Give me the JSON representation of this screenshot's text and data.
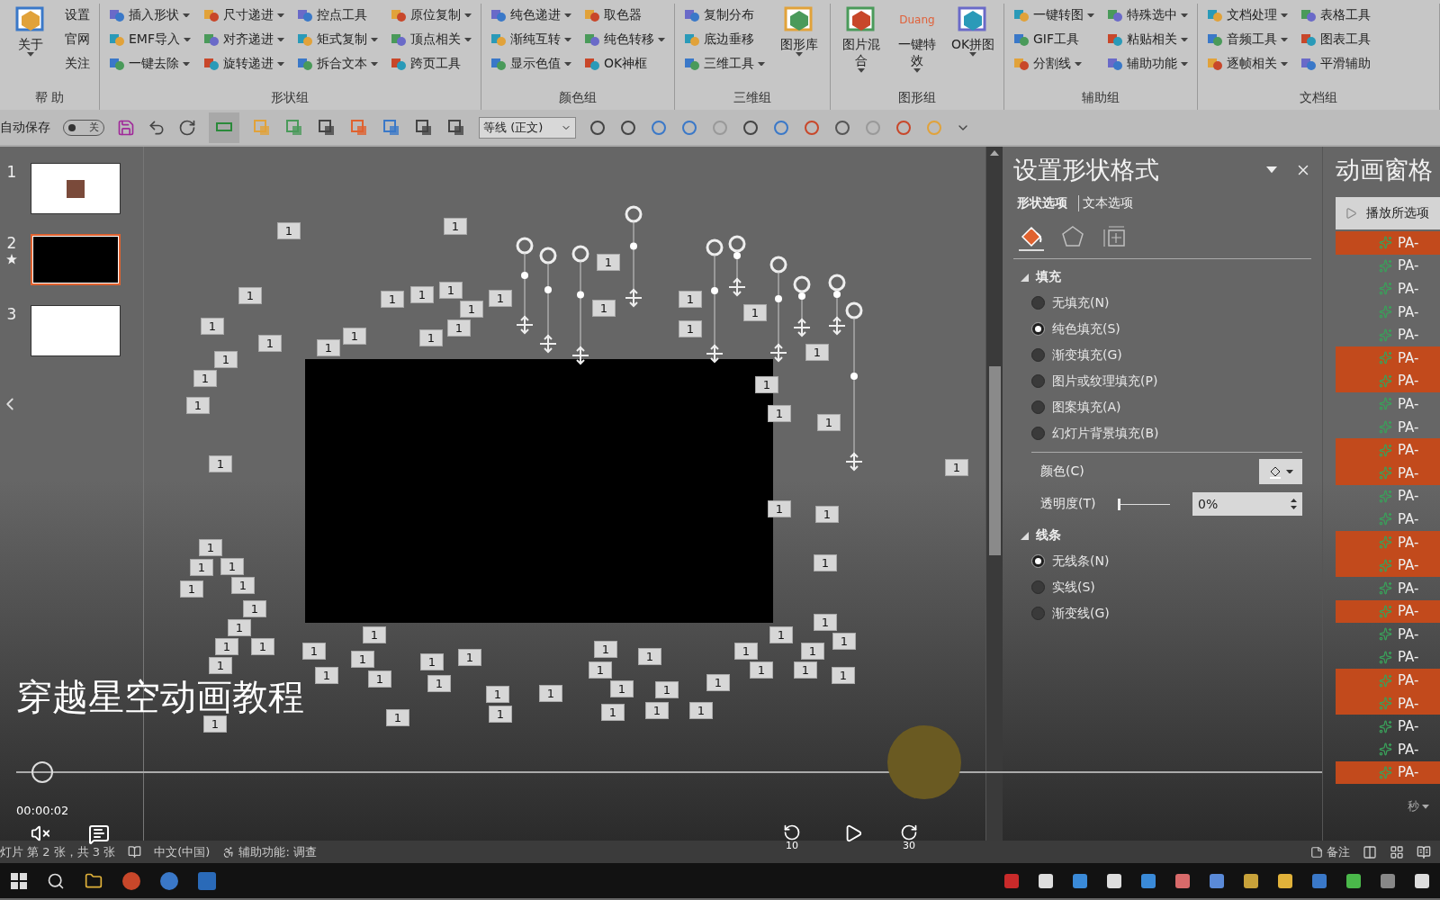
{
  "ribbon": {
    "groups": [
      {
        "label": "帮 助",
        "columns": [
          [
            {
              "label": "关于",
              "kind": "large",
              "dropdown": true
            }
          ],
          [
            {
              "label": "设置",
              "kind": "plain",
              "dropdown": false
            },
            {
              "label": "官网",
              "kind": "plain",
              "dropdown": false
            },
            {
              "label": "关注",
              "kind": "plain",
              "dropdown": false
            }
          ]
        ]
      },
      {
        "label": "形状组",
        "columns": [
          [
            {
              "label": "插入形状",
              "kind": "small",
              "dropdown": true
            },
            {
              "label": "EMF导入",
              "kind": "small",
              "dropdown": true
            },
            {
              "label": "一键去除",
              "kind": "small",
              "dropdown": true
            }
          ],
          [
            {
              "label": "尺寸递进",
              "kind": "small",
              "dropdown": true
            },
            {
              "label": "对齐递进",
              "kind": "small",
              "dropdown": true
            },
            {
              "label": "旋转递进",
              "kind": "small",
              "dropdown": true
            }
          ],
          [
            {
              "label": "控点工具",
              "kind": "small",
              "dropdown": false
            },
            {
              "label": "矩式复制",
              "kind": "small",
              "dropdown": true
            },
            {
              "label": "拆合文本",
              "kind": "small",
              "dropdown": true
            }
          ],
          [
            {
              "label": "原位复制",
              "kind": "small",
              "dropdown": true
            },
            {
              "label": "顶点相关",
              "kind": "small",
              "dropdown": true
            },
            {
              "label": "跨页工具",
              "kind": "small",
              "dropdown": false
            }
          ]
        ]
      },
      {
        "label": "颜色组",
        "columns": [
          [
            {
              "label": "纯色递进",
              "kind": "small",
              "dropdown": true
            },
            {
              "label": "渐纯互转",
              "kind": "small",
              "dropdown": true
            },
            {
              "label": "显示色值",
              "kind": "small",
              "dropdown": true
            }
          ],
          [
            {
              "label": "取色器",
              "kind": "small",
              "dropdown": false
            },
            {
              "label": "纯色转移",
              "kind": "small",
              "dropdown": true
            },
            {
              "label": "OK神框",
              "kind": "small",
              "dropdown": false
            }
          ]
        ]
      },
      {
        "label": "三维组",
        "columns": [
          [
            {
              "label": "复制分布",
              "kind": "small",
              "dropdown": false
            },
            {
              "label": "底边垂移",
              "kind": "small",
              "dropdown": false
            },
            {
              "label": "三维工具",
              "kind": "small",
              "dropdown": true
            }
          ],
          [
            {
              "label": "图形库",
              "kind": "large",
              "dropdown": true
            }
          ]
        ]
      },
      {
        "label": "图形组",
        "columns": [
          [
            {
              "label": "图片混合",
              "kind": "large",
              "dropdown": true
            }
          ],
          [
            {
              "label": "一键特效",
              "kind": "large",
              "dropdown": true,
              "badge": "Duang"
            }
          ],
          [
            {
              "label": "OK拼图",
              "kind": "large",
              "dropdown": true
            }
          ]
        ]
      },
      {
        "label": "辅助组",
        "columns": [
          [
            {
              "label": "一键转图",
              "kind": "small",
              "dropdown": true
            },
            {
              "label": "GIF工具",
              "kind": "small",
              "dropdown": false
            },
            {
              "label": "分割线",
              "kind": "small",
              "dropdown": true
            }
          ],
          [
            {
              "label": "特殊选中",
              "kind": "small",
              "dropdown": true
            },
            {
              "label": "粘贴相关",
              "kind": "small",
              "dropdown": true
            },
            {
              "label": "辅助功能",
              "kind": "small",
              "dropdown": true
            }
          ]
        ]
      },
      {
        "label": "文档组",
        "columns": [
          [
            {
              "label": "文档处理",
              "kind": "small",
              "dropdown": true
            },
            {
              "label": "音频工具",
              "kind": "small",
              "dropdown": true
            },
            {
              "label": "逐帧相关",
              "kind": "small",
              "dropdown": true
            }
          ],
          [
            {
              "label": "表格工具",
              "kind": "small",
              "dropdown": false
            },
            {
              "label": "图表工具",
              "kind": "small",
              "dropdown": false
            },
            {
              "label": "平滑辅助",
              "kind": "small",
              "dropdown": false
            }
          ]
        ]
      }
    ]
  },
  "quick_access": {
    "autosave_label": "自动保存",
    "autosave_on": false,
    "autosave_state": "关",
    "font": "等线 (正文)"
  },
  "slides": [
    {
      "number": "1",
      "selected": false,
      "animated": false,
      "kind": "picture"
    },
    {
      "number": "2",
      "selected": true,
      "animated": true,
      "kind": "black"
    },
    {
      "number": "3",
      "selected": false,
      "animated": false,
      "kind": "blank"
    }
  ],
  "canvas": {
    "tags": [
      "1",
      "1",
      "1",
      "1",
      "1",
      "1",
      "1",
      "1",
      "1",
      "1",
      "1",
      "1",
      "1",
      "1",
      "1",
      "1",
      "1",
      "1",
      "1",
      "1",
      "1",
      "1",
      "1",
      "1",
      "1",
      "1",
      "1",
      "1",
      "1",
      "1",
      "1",
      "1",
      "1",
      "1",
      "1",
      "1",
      "1",
      "1",
      "1",
      "1",
      "1",
      "1",
      "1",
      "1",
      "1",
      "1",
      "1",
      "1",
      "1",
      "1",
      "1",
      "1",
      "1",
      "1",
      "1",
      "1",
      "1",
      "1",
      "1",
      "1",
      "1",
      "1",
      "1",
      "1",
      "1",
      "1",
      "1",
      "1",
      "1",
      "1",
      "1"
    ]
  },
  "video": {
    "title": "穿越星空动画教程",
    "time": "00:00:02",
    "progress": {
      "level": 0.02
    },
    "rewind": "10",
    "forward": "30"
  },
  "format_pane": {
    "title": "设置形状格式",
    "tabs": [
      {
        "label": "形状选项",
        "selected": true
      },
      {
        "label": "文本选项",
        "selected": false
      }
    ],
    "icon_tabs": [
      {
        "kind": "fill",
        "selected": true
      },
      {
        "kind": "effects",
        "selected": false
      },
      {
        "kind": "size",
        "selected": false
      }
    ],
    "sections": [
      {
        "label": "填充",
        "expanded": true,
        "options": [
          {
            "label": "无填充(N)",
            "selected": false
          },
          {
            "label": "纯色填充(S)",
            "selected": true
          },
          {
            "label": "渐变填充(G)",
            "selected": false
          },
          {
            "label": "图片或纹理填充(P)",
            "selected": false
          },
          {
            "label": "图案填充(A)",
            "selected": false
          },
          {
            "label": "幻灯片背景填充(B)",
            "selected": false
          }
        ],
        "color_label": "颜色(C)",
        "transparency": {
          "label": "透明度(T)",
          "level": 0,
          "value": "0%"
        }
      },
      {
        "label": "线条",
        "expanded": true,
        "options": [
          {
            "label": "无线条(N)",
            "selected": true
          },
          {
            "label": "实线(S)",
            "selected": false
          },
          {
            "label": "渐变线(G)",
            "selected": false
          }
        ]
      }
    ]
  },
  "animation_pane": {
    "title": "动画窗格",
    "play_button": "播放所选项",
    "items": [
      {
        "label": "PA-",
        "selected": true
      },
      {
        "label": "PA-",
        "selected": false
      },
      {
        "label": "PA-",
        "selected": false
      },
      {
        "label": "PA-",
        "selected": false
      },
      {
        "label": "PA-",
        "selected": false
      },
      {
        "label": "PA-",
        "selected": true
      },
      {
        "label": "PA-",
        "selected": true
      },
      {
        "label": "PA-",
        "selected": false
      },
      {
        "label": "PA-",
        "selected": false
      },
      {
        "label": "PA-",
        "selected": true
      },
      {
        "label": "PA-",
        "selected": true
      },
      {
        "label": "PA-",
        "selected": false
      },
      {
        "label": "PA-",
        "selected": false
      },
      {
        "label": "PA-",
        "selected": true
      },
      {
        "label": "PA-",
        "selected": true
      },
      {
        "label": "PA-",
        "selected": false
      },
      {
        "label": "PA-",
        "selected": true
      },
      {
        "label": "PA-",
        "selected": false
      },
      {
        "label": "PA-",
        "selected": false
      },
      {
        "label": "PA-",
        "selected": true
      },
      {
        "label": "PA-",
        "selected": true
      },
      {
        "label": "PA-",
        "selected": false
      },
      {
        "label": "PA-",
        "selected": false
      },
      {
        "label": "PA-",
        "selected": true
      }
    ],
    "footer": "秒"
  },
  "status_bar": {
    "slide_info": "灯片 第 2 张，共 3 张",
    "language": "中文(中国)",
    "accessibility": "辅助功能: 调查",
    "notes": "备注"
  }
}
